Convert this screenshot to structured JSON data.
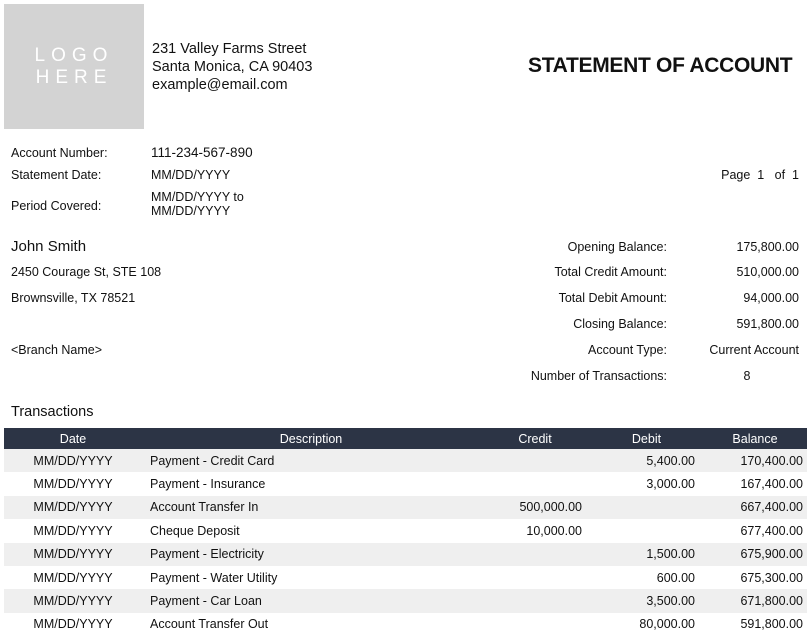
{
  "logo": {
    "line1": "LOGO",
    "line2": "HERE"
  },
  "company": {
    "street": "231 Valley Farms Street",
    "city": "Santa Monica, CA 90403",
    "email": "example@email.com"
  },
  "title": "STATEMENT OF ACCOUNT",
  "meta": {
    "account_number_label": "Account Number:",
    "account_number": "111-234-567-890",
    "statement_date_label": "Statement Date:",
    "statement_date": "MM/DD/YYYY",
    "period_label": "Period Covered:",
    "period_line1": "MM/DD/YYYY to",
    "period_line2": "MM/DD/YYYY"
  },
  "page": {
    "label": "Page",
    "current": "1",
    "of_label": "of",
    "total": "1"
  },
  "customer": {
    "name": "John Smith",
    "address1": "2450 Courage St, STE 108",
    "address2": "Brownsville, TX 78521",
    "branch": "<Branch Name>"
  },
  "summary": [
    {
      "label": "Opening Balance:",
      "value": "175,800.00"
    },
    {
      "label": "Total Credit Amount:",
      "value": "510,000.00"
    },
    {
      "label": "Total Debit Amount:",
      "value": "94,000.00"
    },
    {
      "label": "Closing Balance:",
      "value": "591,800.00"
    },
    {
      "label": "Account Type:",
      "value": "Current Account"
    },
    {
      "label": "Number of Transactions:",
      "value": "8"
    }
  ],
  "transactions": {
    "heading": "Transactions",
    "columns": [
      "Date",
      "Description",
      "Credit",
      "Debit",
      "Balance"
    ],
    "rows": [
      {
        "date": "MM/DD/YYYY",
        "description": "Payment - Credit Card",
        "credit": "",
        "debit": "5,400.00",
        "balance": "170,400.00"
      },
      {
        "date": "MM/DD/YYYY",
        "description": "Payment - Insurance",
        "credit": "",
        "debit": "3,000.00",
        "balance": "167,400.00"
      },
      {
        "date": "MM/DD/YYYY",
        "description": "Account Transfer In",
        "credit": "500,000.00",
        "debit": "",
        "balance": "667,400.00"
      },
      {
        "date": "MM/DD/YYYY",
        "description": "Cheque Deposit",
        "credit": "10,000.00",
        "debit": "",
        "balance": "677,400.00"
      },
      {
        "date": "MM/DD/YYYY",
        "description": "Payment - Electricity",
        "credit": "",
        "debit": "1,500.00",
        "balance": "675,900.00"
      },
      {
        "date": "MM/DD/YYYY",
        "description": "Payment - Water Utility",
        "credit": "",
        "debit": "600.00",
        "balance": "675,300.00"
      },
      {
        "date": "MM/DD/YYYY",
        "description": "Payment - Car Loan",
        "credit": "",
        "debit": "3,500.00",
        "balance": "671,800.00"
      },
      {
        "date": "MM/DD/YYYY",
        "description": "Account Transfer Out",
        "credit": "",
        "debit": "80,000.00",
        "balance": "591,800.00"
      }
    ]
  },
  "colors": {
    "header_bg": "#2c3445",
    "stripe": "#efefef",
    "logo_bg": "#d3d3d3"
  }
}
